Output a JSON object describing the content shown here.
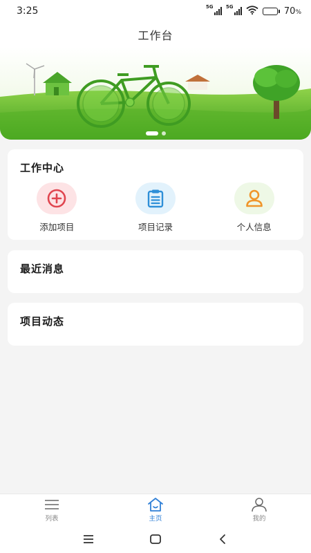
{
  "status_bar": {
    "time": "3:25",
    "network_label_1": "5G",
    "network_label_2": "5G",
    "battery_percent": "70",
    "battery_sign": "%",
    "battery_level": 0.7
  },
  "header": {
    "title": "工作台"
  },
  "banner": {
    "slide_count": 2,
    "active_slide": 0
  },
  "work_center": {
    "title": "工作中心",
    "actions": [
      {
        "label": "添加项目",
        "icon": "add-circle-icon",
        "color": "#e0454f"
      },
      {
        "label": "项目记录",
        "icon": "clipboard-list-icon",
        "color": "#2e8fd8"
      },
      {
        "label": "个人信息",
        "icon": "user-icon",
        "color": "#f0952a"
      }
    ]
  },
  "recent_messages": {
    "title": "最近消息"
  },
  "project_updates": {
    "title": "项目动态"
  },
  "tab_bar": {
    "active": "主页",
    "accent_color": "#2f7fd6",
    "items": [
      {
        "label": "列表",
        "icon": "list-icon"
      },
      {
        "label": "主页",
        "icon": "home-icon"
      },
      {
        "label": "我的",
        "icon": "profile-icon"
      }
    ]
  },
  "system_nav": {
    "buttons": [
      "menu-icon",
      "home-square-icon",
      "back-icon"
    ]
  }
}
